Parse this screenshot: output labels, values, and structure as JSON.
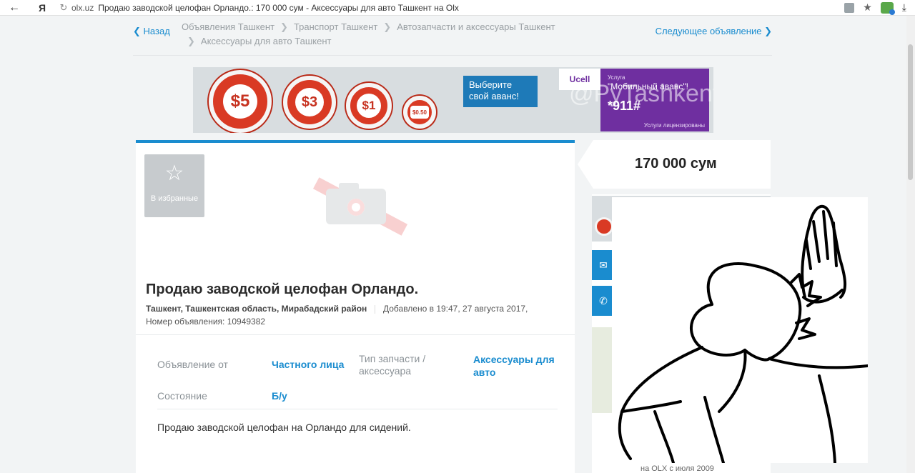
{
  "browser": {
    "domain": "olx.uz",
    "title": "Продаю заводской целофан Орландо.: 170 000 сум - Аксессуары для авто Ташкент на Olx",
    "yandex_label": "Я"
  },
  "nav": {
    "back_label": "Назад",
    "next_label": "Следующее объявление",
    "breadcrumbs": [
      "Объявления Ташкент",
      "Транспорт Ташкент",
      "Автозапчасти и аксессуары Ташкент",
      "Аксессуары для авто Ташкент"
    ]
  },
  "banner": {
    "amounts": [
      "$5",
      "$3",
      "$1",
      "$0.50"
    ],
    "cta": "Выберите свой аванс!",
    "brand": "Ucell",
    "service_label": "Услуга",
    "service_name": "\"Мобильный аванс\"!",
    "code": "*911#",
    "license": "Услуги лицензированы",
    "watermark": "@PyTashkent"
  },
  "ad": {
    "favorite_label": "В избранные",
    "title": "Продаю заводской целофан Орландо.",
    "location": "Ташкент, Ташкентская область, Мирабадский район",
    "added": "Добавлено в 19:47, 27 августа 2017,",
    "number": "Номер объявления: 10949382",
    "params": [
      {
        "label": "Объявление от",
        "value": "Частного лица"
      },
      {
        "label": "Тип запчасти / аксессуара",
        "value": "Аксессуары для авто"
      },
      {
        "label": "Состояние",
        "value": "Б/у"
      }
    ],
    "description": "Продаю заводской целофан на Орландо для сидений."
  },
  "sidebar": {
    "price": "170 000 сум",
    "member_since": "на OLX с июля 2009"
  },
  "icons": {
    "back": "arrow-left-icon",
    "star": "star-icon",
    "camera": "camera-icon",
    "mail": "mail-icon",
    "phone": "phone-icon"
  },
  "colors": {
    "accent": "#1a8ccf",
    "banner_red": "#d93a24",
    "ucell_purple": "#6f2fa0"
  }
}
